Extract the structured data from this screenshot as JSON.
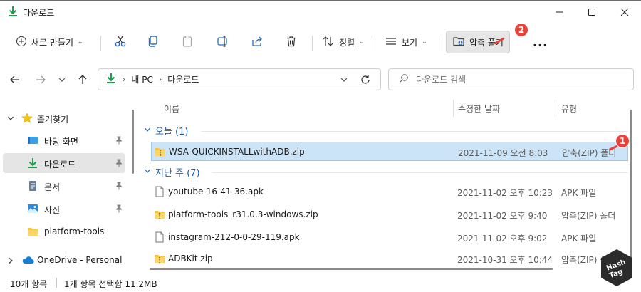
{
  "window": {
    "title": "다운로드"
  },
  "commandbar": {
    "new_label": "새로 만들기",
    "sort_label": "정렬",
    "view_label": "보기",
    "extract_label": "압축 풀기",
    "more_label": "...",
    "badge_extract": "2"
  },
  "nav": {
    "breadcrumbs": [
      "내 PC",
      "다운로드"
    ],
    "search_placeholder": "다운로드 검색"
  },
  "sidebar": {
    "favorites_label": "즐겨찾기",
    "items": [
      {
        "label": "바탕 화면"
      },
      {
        "label": "다운로드"
      },
      {
        "label": "문서"
      },
      {
        "label": "사진"
      },
      {
        "label": "platform-tools"
      }
    ],
    "onedrive_label": "OneDrive - Personal"
  },
  "columns": {
    "name": "이름",
    "date": "수정한 날짜",
    "type": "유형"
  },
  "groups": [
    {
      "label": "오늘 (1)"
    },
    {
      "label": "지난 주 (7)"
    }
  ],
  "files": [
    {
      "name": "WSA-QUICKINSTALLwithADB.zip",
      "date": "2021-11-09 오전 8:03",
      "type": "압축(ZIP) 폴더",
      "icon": "zip-folder-icon"
    },
    {
      "name": "youtube-16-41-36.apk",
      "date": "2021-11-02 오후 10:23",
      "type": "APK 파일",
      "icon": "file-icon"
    },
    {
      "name": "platform-tools_r31.0.3-windows.zip",
      "date": "2021-11-02 오후 9:40",
      "type": "압축(ZIP) 폴더",
      "icon": "zip-folder-icon"
    },
    {
      "name": "instagram-212-0-0-29-119.apk",
      "date": "2021-11-02 오후 9:02",
      "type": "APK 파일",
      "icon": "file-icon"
    },
    {
      "name": "ADBKit.zip",
      "date": "2021-10-31 오후 10:44",
      "type": "압축(ZIP) 폴더",
      "icon": "zip-folder-icon"
    }
  ],
  "badge_row": "1",
  "status": {
    "count": "10개 항목",
    "selection": "1개 항목 선택함 11.2MB"
  },
  "watermark": {
    "text_1": "Hash",
    "text_2": "Tag"
  },
  "colors": {
    "accent": "#0a7fd1",
    "selection": "#cce4f7",
    "badge": "#e8423b",
    "download_green": "#1e9e4a",
    "group_blue": "#1a5fb4"
  }
}
